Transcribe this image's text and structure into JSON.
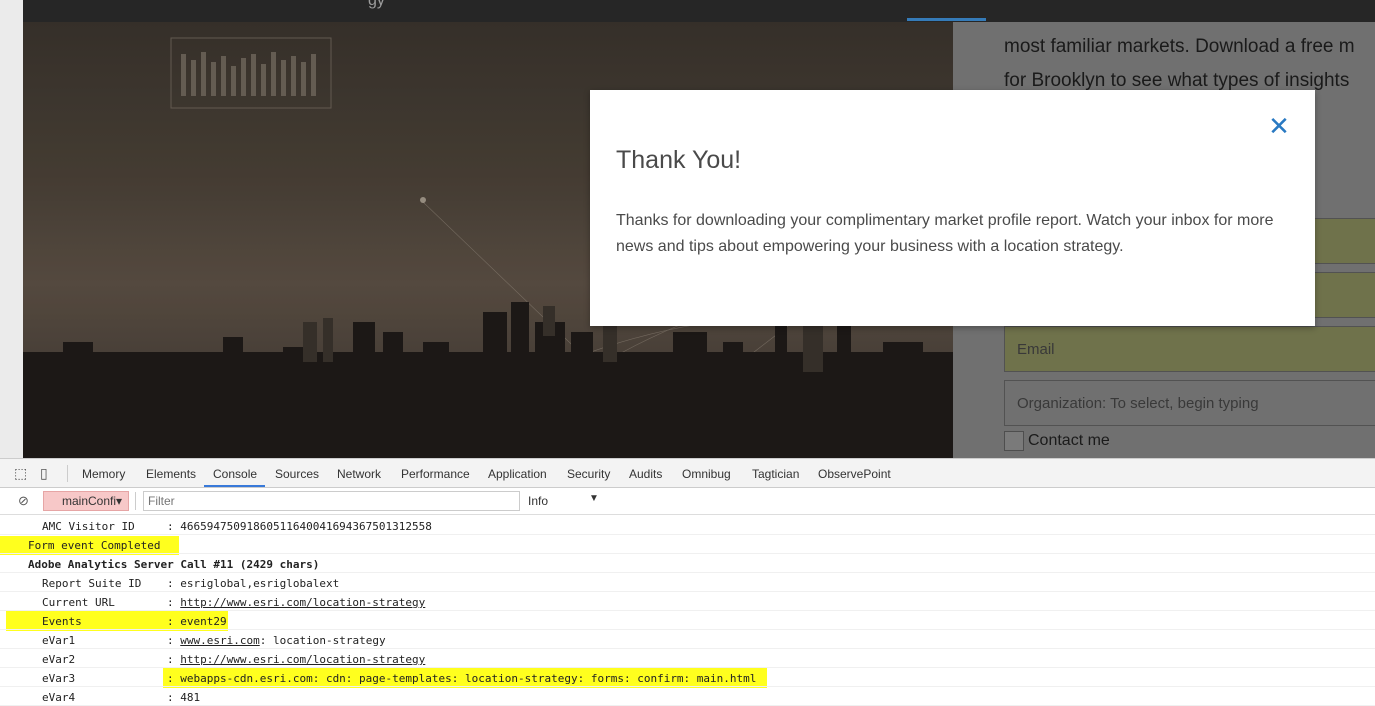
{
  "page": {
    "blurb_line1": "most familiar markets. Download a free m",
    "blurb_line2": "for Brooklyn to see what types of insights",
    "email_placeholder": "Email",
    "org_placeholder": "Organization: To select, begin typing",
    "contact_label": "Contact me"
  },
  "modal": {
    "close_icon": "close-icon",
    "title": "Thank You!",
    "body": "Thanks for downloading your complimentary market profile report. Watch your inbox for more news and tips about empowering your business with a location strategy."
  },
  "devtools": {
    "tabs": [
      "Memory",
      "Elements",
      "Console",
      "Sources",
      "Network",
      "Performance",
      "Application",
      "Security",
      "Audits",
      "Omnibug",
      "Tagtician",
      "ObservePoint"
    ],
    "active_tab": "Console",
    "context": "mainConfi",
    "filter_placeholder": "Filter",
    "level": "Info"
  },
  "console": {
    "amc_key": "AMC Visitor ID",
    "amc_value": ": 46659475091860511640041694367501312558",
    "form_event": "Form event Completed",
    "server_call": "Adobe Analytics Server Call #11 (2429 chars)",
    "rsid_key": "Report Suite ID",
    "rsid_value": ": esriglobal,esriglobalext",
    "url_key": "Current URL",
    "url_prefix": ": ",
    "url_value": "http://www.esri.com/location-strategy",
    "events_key": "Events",
    "events_value": ": event29",
    "evar1_key": "eVar1",
    "evar1_prefix": ": ",
    "evar1_link": "www.esri.com",
    "evar1_suffix": ": location-strategy",
    "evar2_key": "eVar2",
    "evar2_prefix": ": ",
    "evar2_value": "http://www.esri.com/location-strategy",
    "evar3_key": "eVar3",
    "evar3_value": ": webapps-cdn.esri.com: cdn: page-templates: location-strategy: forms: confirm: main.html",
    "evar4_key": "eVar4",
    "evar4_value": ": 481"
  },
  "colors": {
    "highlight": "#ffff1e",
    "accent": "#3879d9",
    "close": "#2979c2"
  }
}
